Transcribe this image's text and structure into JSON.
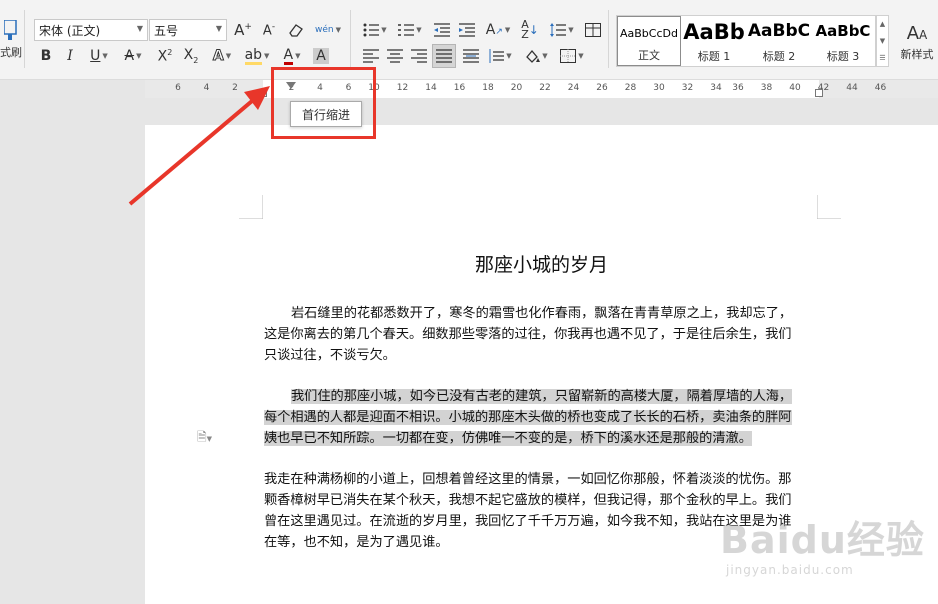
{
  "ribbon": {
    "format_painter_label": "式刷",
    "font_name": "宋体 (正文)",
    "font_size": "五号",
    "pinyin_glyph": "wén",
    "new_style_label": "新样式",
    "styles": [
      {
        "sample": "AaBbCcDd",
        "label": "正文"
      },
      {
        "sample": "AaBb",
        "label": "标题 1"
      },
      {
        "sample": "AaBbC",
        "label": "标题 2"
      },
      {
        "sample": "AaBbC",
        "label": "标题 3"
      }
    ],
    "colors": {
      "font_color": "#c00000",
      "highlight": "#ffd966",
      "accent": "#e8362a"
    }
  },
  "ruler": {
    "left_numbers": [
      "6",
      "4",
      "2",
      "2",
      "4",
      "6"
    ],
    "right_numbers": [
      "36",
      "38",
      "40",
      "42",
      "44",
      "46"
    ],
    "middle_numbers": [
      "10",
      "12",
      "14",
      "16",
      "18",
      "20",
      "22",
      "24",
      "26",
      "28",
      "30",
      "32",
      "34"
    ]
  },
  "tooltip": {
    "text": "首行缩进"
  },
  "document": {
    "title": "那座小城的岁月",
    "paragraphs": [
      {
        "lines": [
          "岩石缝里的花都悉数开了，寒冬的霜雪也化作春雨，飘落在青青草原之上，我却忘了，",
          "这是你离去的第几个春天。细数那些零落的过往，你我再也遇不见了，于是往后余生，我们",
          "只谈过往，不谈亏欠。"
        ]
      },
      {
        "lines": [
          "我们住的那座小城，如今已没有古老的建筑，只留崭新的高楼大厦，隔着厚墙的人海，",
          "每个相遇的人都是迎面不相识。小城的那座木头做的桥也变成了长长的石桥，卖油条的胖阿",
          "姨也早已不知所踪。一切都在变，仿佛唯一不变的是，桥下的溪水还是那般的清澈。"
        ]
      },
      {
        "lines": [
          "我走在种满杨柳的小道上，回想着曾经这里的情景，一如回忆你那般，怀着淡淡的忧伤。那",
          "颗香樟树早已消失在某个秋天，我想不起它盛放的模样，但我记得，那个金秋的早上。我们",
          "曾在这里遇见过。在流逝的岁月里，我回忆了千千万万遍，如今我不知，我站在这里是为谁",
          "在等，也不知，是为了遇见谁。"
        ]
      }
    ]
  },
  "watermark": {
    "brand": "Baidu经验",
    "url": "jingyan.baidu.com"
  },
  "icons": [
    "format-painter-icon",
    "grow-font-icon",
    "shrink-font-icon",
    "clear-format-icon",
    "pinyin-icon",
    "bold-icon",
    "italic-icon",
    "underline-icon",
    "strikethrough-icon",
    "superscript-icon",
    "subscript-icon",
    "text-effect-icon",
    "highlight-icon",
    "font-color-icon",
    "char-shading-icon",
    "bullets-icon",
    "numbering-icon",
    "decrease-indent-icon",
    "increase-indent-icon",
    "text-direction-icon",
    "sort-icon",
    "line-spacing-icon",
    "table-icon",
    "align-left-icon",
    "align-center-icon",
    "align-right-icon",
    "justify-icon",
    "distributed-icon",
    "shading-icon",
    "borders-icon",
    "paragraph-mark-icon"
  ]
}
